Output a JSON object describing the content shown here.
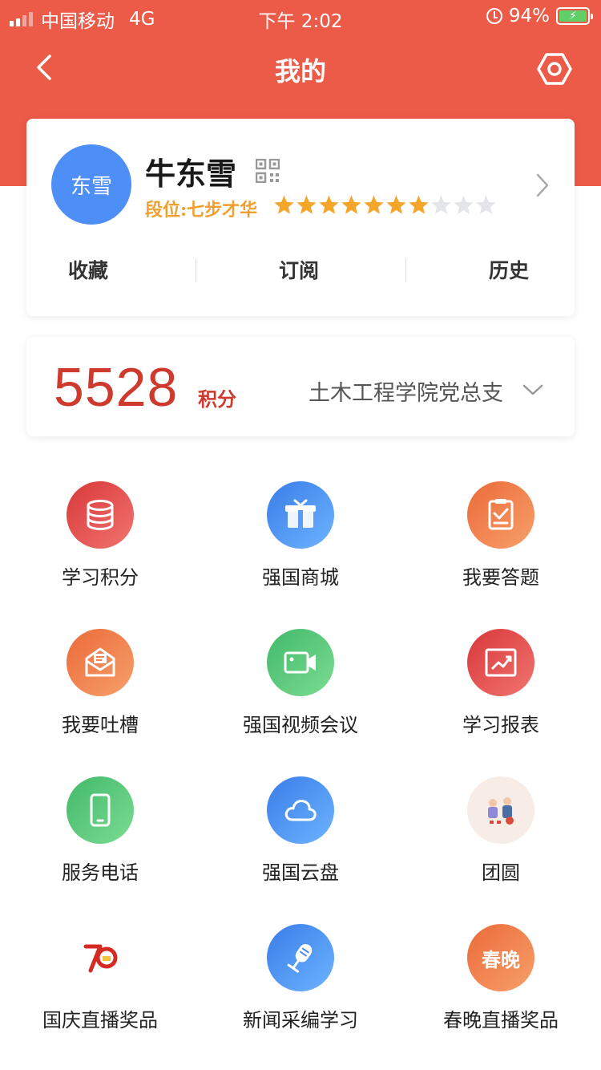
{
  "status_bar": {
    "carrier": "中国移动",
    "network": "4G",
    "time": "下午 2:02",
    "battery": "94%"
  },
  "nav": {
    "title": "我的"
  },
  "profile": {
    "avatar_text": "东雪",
    "name": "牛东雪",
    "rank": "段位:七步才华",
    "stars_filled": 7,
    "stars_total": 10,
    "tabs": [
      "收藏",
      "订阅",
      "历史"
    ]
  },
  "points": {
    "value": "5528",
    "unit": "积分",
    "org": "土木工程学院党总支"
  },
  "grid": [
    {
      "label": "学习积分",
      "icon": "database-icon",
      "color": "red"
    },
    {
      "label": "强国商城",
      "icon": "gift-box-icon",
      "color": "blue"
    },
    {
      "label": "我要答题",
      "icon": "clipboard-check-icon",
      "color": "orange"
    },
    {
      "label": "我要吐槽",
      "icon": "envelope-icon",
      "color": "orange"
    },
    {
      "label": "强国视频会议",
      "icon": "video-camera-icon",
      "color": "green"
    },
    {
      "label": "学习报表",
      "icon": "chart-trend-icon",
      "color": "red"
    },
    {
      "label": "服务电话",
      "icon": "mobile-phone-icon",
      "color": "green"
    },
    {
      "label": "强国云盘",
      "icon": "cloud-icon",
      "color": "blue"
    },
    {
      "label": "团圆",
      "icon": "reunion-illustration-icon",
      "color": "pale"
    },
    {
      "label": "国庆直播奖品",
      "icon": "seventy-anniversary-icon",
      "color": "white"
    },
    {
      "label": "新闻采编学习",
      "icon": "microphone-icon",
      "color": "blue"
    },
    {
      "label": "春晚直播奖品",
      "icon": "spring-festival-icon",
      "color": "orange",
      "icon_text": "春晚"
    }
  ]
}
